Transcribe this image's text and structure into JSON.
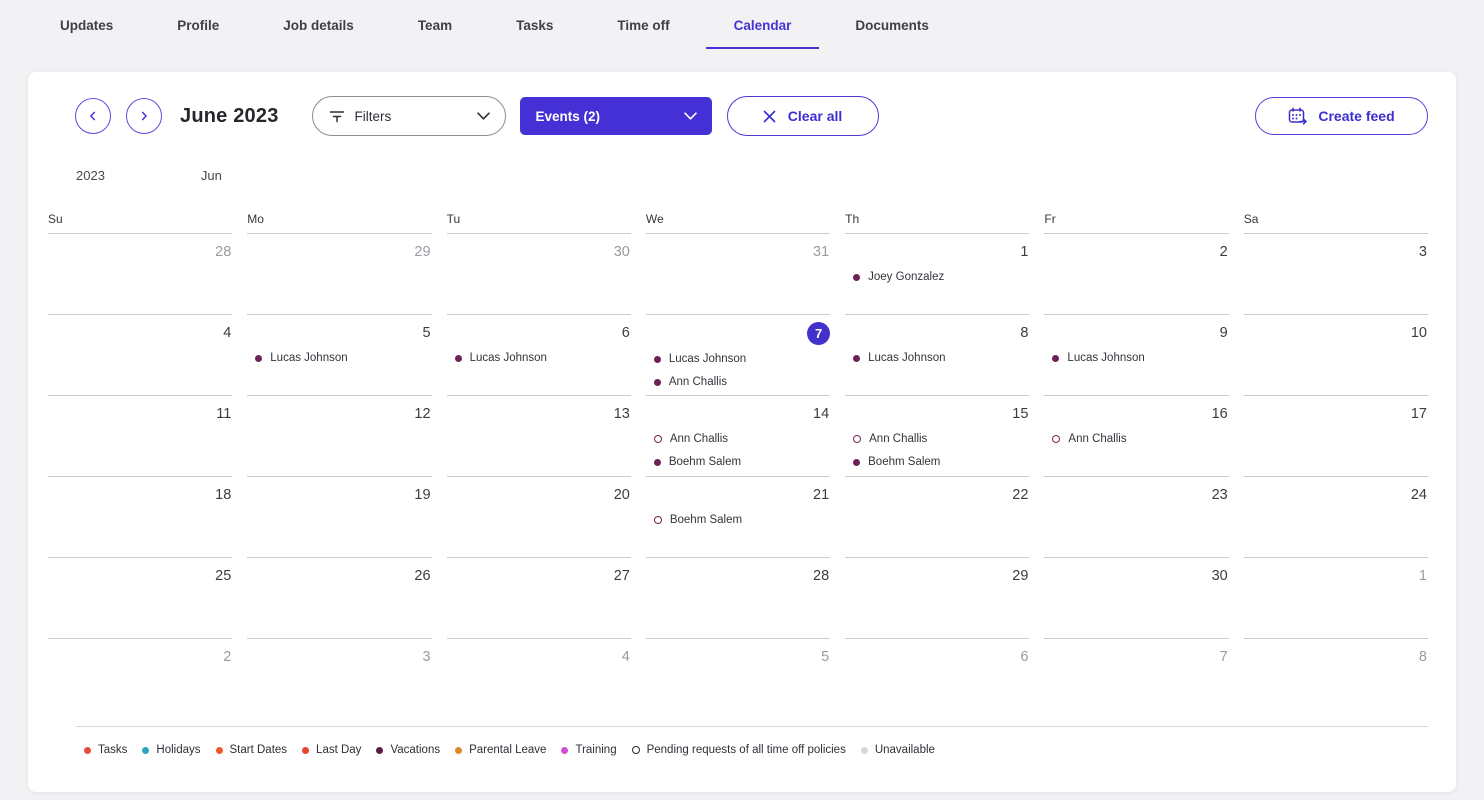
{
  "tabs": [
    {
      "label": "Updates",
      "active": false
    },
    {
      "label": "Profile",
      "active": false
    },
    {
      "label": "Job details",
      "active": false
    },
    {
      "label": "Team",
      "active": false
    },
    {
      "label": "Tasks",
      "active": false
    },
    {
      "label": "Time off",
      "active": false
    },
    {
      "label": "Calendar",
      "active": true
    },
    {
      "label": "Documents",
      "active": false
    }
  ],
  "toolbar": {
    "month_title": "June 2023",
    "filters_label": "Filters",
    "events_label": "Events (2)",
    "clear_all_label": "Clear all",
    "create_feed_label": "Create feed"
  },
  "calendar": {
    "year_label": "2023",
    "month_label": "Jun",
    "day_headers": [
      "Su",
      "Mo",
      "Tu",
      "We",
      "Th",
      "Fr",
      "Sa"
    ],
    "today_date": "7",
    "weeks": [
      [
        {
          "day": "28",
          "outside": true
        },
        {
          "day": "29",
          "outside": true
        },
        {
          "day": "30",
          "outside": true
        },
        {
          "day": "31",
          "outside": true
        },
        {
          "day": "1",
          "events": [
            {
              "name": "Joey Gonzalez",
              "dot": "filled"
            }
          ]
        },
        {
          "day": "2"
        },
        {
          "day": "3"
        }
      ],
      [
        {
          "day": "4"
        },
        {
          "day": "5",
          "events": [
            {
              "name": "Lucas Johnson",
              "dot": "filled"
            }
          ]
        },
        {
          "day": "6",
          "events": [
            {
              "name": "Lucas Johnson",
              "dot": "filled"
            }
          ]
        },
        {
          "day": "7",
          "today": true,
          "events": [
            {
              "name": "Lucas Johnson",
              "dot": "filled"
            },
            {
              "name": "Ann Challis",
              "dot": "filled"
            }
          ]
        },
        {
          "day": "8",
          "events": [
            {
              "name": "Lucas Johnson",
              "dot": "filled"
            }
          ]
        },
        {
          "day": "9",
          "events": [
            {
              "name": "Lucas Johnson",
              "dot": "filled"
            }
          ]
        },
        {
          "day": "10"
        }
      ],
      [
        {
          "day": "11"
        },
        {
          "day": "12"
        },
        {
          "day": "13"
        },
        {
          "day": "14",
          "events": [
            {
              "name": "Ann Challis",
              "dot": "hollow"
            },
            {
              "name": "Boehm Salem",
              "dot": "filled"
            }
          ]
        },
        {
          "day": "15",
          "events": [
            {
              "name": "Ann Challis",
              "dot": "hollow"
            },
            {
              "name": "Boehm Salem",
              "dot": "filled"
            }
          ]
        },
        {
          "day": "16",
          "events": [
            {
              "name": "Ann Challis",
              "dot": "hollow"
            }
          ]
        },
        {
          "day": "17"
        }
      ],
      [
        {
          "day": "18"
        },
        {
          "day": "19"
        },
        {
          "day": "20"
        },
        {
          "day": "21",
          "events": [
            {
              "name": "Boehm Salem",
              "dot": "hollow"
            }
          ]
        },
        {
          "day": "22"
        },
        {
          "day": "23"
        },
        {
          "day": "24"
        }
      ],
      [
        {
          "day": "25"
        },
        {
          "day": "26"
        },
        {
          "day": "27"
        },
        {
          "day": "28"
        },
        {
          "day": "29"
        },
        {
          "day": "30"
        },
        {
          "day": "1",
          "outside": true
        }
      ],
      [
        {
          "day": "2",
          "outside": true
        },
        {
          "day": "3",
          "outside": true
        },
        {
          "day": "4",
          "outside": true
        },
        {
          "day": "5",
          "outside": true
        },
        {
          "day": "6",
          "outside": true
        },
        {
          "day": "7",
          "outside": true
        },
        {
          "day": "8",
          "outside": true
        }
      ]
    ]
  },
  "legend": [
    {
      "label": "Tasks",
      "color": "#e64a3a",
      "style": "filled"
    },
    {
      "label": "Holidays",
      "color": "#2aa5c4",
      "style": "filled"
    },
    {
      "label": "Start Dates",
      "color": "#ef5a2b",
      "style": "filled"
    },
    {
      "label": "Last Day",
      "color": "#e6452b",
      "style": "filled"
    },
    {
      "label": "Vacations",
      "color": "#5c1b47",
      "style": "filled"
    },
    {
      "label": "Parental Leave",
      "color": "#df8a2a",
      "style": "filled"
    },
    {
      "label": "Training",
      "color": "#d14ed1",
      "style": "filled"
    },
    {
      "label": "Pending requests of all time off policies",
      "color": "#2b2b30",
      "style": "hollow"
    },
    {
      "label": "Unavailable",
      "color": "#d7d7db",
      "style": "filled"
    }
  ],
  "colors": {
    "accent": "#4430d4",
    "today_bg": "#4331cb",
    "event_dot_filled": "#6e2156",
    "event_dot_hollow": "#7c2558"
  }
}
